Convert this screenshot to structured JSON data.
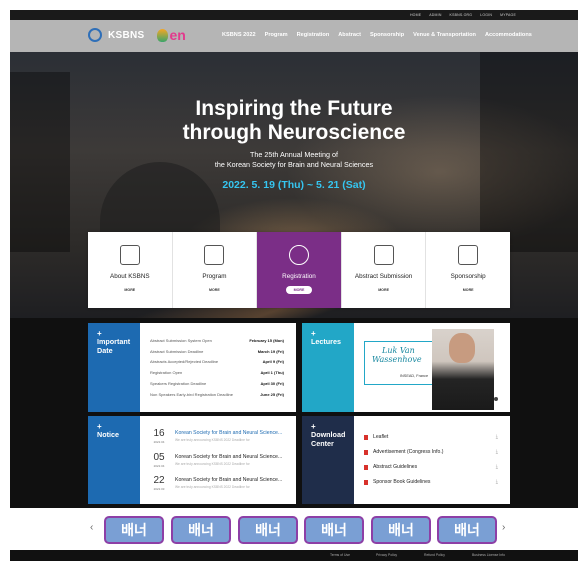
{
  "util": [
    "HOME",
    "ADMIN",
    "KSBNS.ORG",
    "LOGIN",
    "MYPAGE"
  ],
  "brand": {
    "name": "KSBNS",
    "secondary": "en",
    "accent": "#7b2e87"
  },
  "menu": [
    "KSBNS 2022",
    "Program",
    "Registration",
    "Abstract",
    "Sponsorship",
    "Venue & Transportation",
    "Accommodations"
  ],
  "hero": {
    "title_line1": "Inspiring the Future",
    "title_line2": "through Neuroscience",
    "sub1": "The 25th Annual Meeting of",
    "sub2": "the Korean Society for Brain and Neural Sciences",
    "date": "2022. 5. 19 (Thu) ~ 5. 21 (Sat)"
  },
  "quick": [
    {
      "label": "About KSBNS",
      "more": "MORE",
      "icon": "brain-head-icon"
    },
    {
      "label": "Program",
      "more": "MORE",
      "icon": "calendar-icon"
    },
    {
      "label": "Registration",
      "more": "MORE",
      "icon": "register-icon"
    },
    {
      "label": "Abstract Submission",
      "more": "MORE",
      "icon": "document-icon"
    },
    {
      "label": "Sponsorship",
      "more": "MORE",
      "icon": "building-icon"
    }
  ],
  "important": {
    "plus": "+",
    "title": "Important Date",
    "rows": [
      {
        "label": "Abstract Submission System Open",
        "date": "February 15 (Mon)"
      },
      {
        "label": "Abstract Submission Deadline",
        "date": "March 19 (Fri)"
      },
      {
        "label": "Abstracts Accepted/Rejected Deadline",
        "date": "April 9 (Fri)"
      },
      {
        "label": "Registration Open",
        "date": "April 1 (Thu)"
      },
      {
        "label": "Speakers Registration Deadline",
        "date": "April 30 (Fri)"
      },
      {
        "label": "Non Speakers Early-bird Registration Deadline",
        "date": "June 25 (Fri)"
      }
    ]
  },
  "lectures": {
    "plus": "+",
    "title": "Lectures",
    "name_line1": "Luk Van",
    "name_line2": "Wassenhove",
    "affiliation": "INSEAD, France"
  },
  "notice": {
    "plus": "+",
    "title": "Notice",
    "items": [
      {
        "day": "16",
        "ym": "2022.04",
        "title": "Korean Society for Brain and Neural Science...",
        "sub": "We are truly announcing KSBNS 2022 Deadline for"
      },
      {
        "day": "05",
        "ym": "2022.04",
        "title": "Korean Society for Brain and Neural Science...",
        "sub": "We are truly announcing KSBNS 2022 Deadline for"
      },
      {
        "day": "22",
        "ym": "2022.03",
        "title": "Korean Society for Brain and Neural Science...",
        "sub": "We are truly announcing KSBNS 2022 Deadline for"
      }
    ]
  },
  "download": {
    "plus": "+",
    "title": "Download Center",
    "items": [
      "Leaflet",
      "Advertisement (Congress Info.)",
      "Abstract Guidelines",
      "Sponsor Book Guidelines"
    ]
  },
  "banners": {
    "prev": "‹",
    "next": "›",
    "labels": [
      "배너",
      "배너",
      "배너",
      "배너",
      "배너",
      "배너"
    ]
  },
  "footer": [
    "Terms of Use",
    "Privacy Policy",
    "Refund Policy",
    "Business License Info"
  ]
}
